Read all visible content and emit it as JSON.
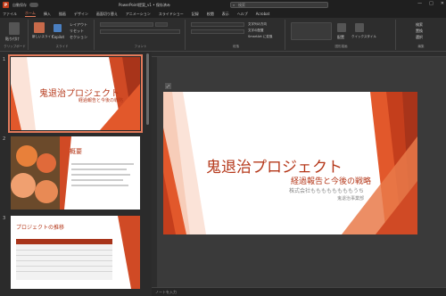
{
  "titlebar": {
    "autosave_label": "自動保存",
    "file_name": "PowerPoint提案_v1 • 保存済み",
    "search_placeholder": "検索",
    "window_controls": [
      "—",
      "□",
      "✕"
    ],
    "app_icon_letter": "P"
  },
  "menu": {
    "items": [
      "ファイル",
      "ホーム",
      "挿入",
      "描画",
      "デザイン",
      "画面切り替え",
      "アニメーション",
      "スライドショー",
      "記録",
      "校閲",
      "表示",
      "ヘルプ",
      "Acrobat"
    ]
  },
  "ribbon": {
    "groups": [
      {
        "label": "クリップボード",
        "buttons": [
          "貼り付け"
        ]
      },
      {
        "label": "スライド",
        "buttons": [
          "新しいスライド",
          "レイアウト",
          "リセット",
          "セクション"
        ]
      },
      {
        "label": "フォント",
        "buttons": []
      },
      {
        "label": "段落",
        "buttons": [
          "文字列の方向",
          "文字の配置",
          "SmartArt に変換"
        ]
      },
      {
        "label": "図形描画",
        "buttons": [
          "配置",
          "クイックスタイル"
        ]
      },
      {
        "label": "編集",
        "buttons": [
          "検索",
          "置換",
          "選択"
        ]
      }
    ],
    "copilot_label": "Copilot"
  },
  "thumbnails": [
    {
      "number": "1",
      "title": "鬼退治プロジェクト",
      "subtitle": "経過報告と今後の戦略"
    },
    {
      "number": "2",
      "title": "概要"
    },
    {
      "number": "3",
      "title": "プロジェクトの推移"
    }
  ],
  "slide": {
    "title": "鬼退治プロジェクト",
    "subtitle": "経過報告と今後の戦略",
    "company": "株式会社ももももももももうち",
    "department": "鬼退治事業部"
  },
  "notes_placeholder": "ノートを入力",
  "colors": {
    "accent": "#b5381a",
    "orange": "#e2582b"
  }
}
